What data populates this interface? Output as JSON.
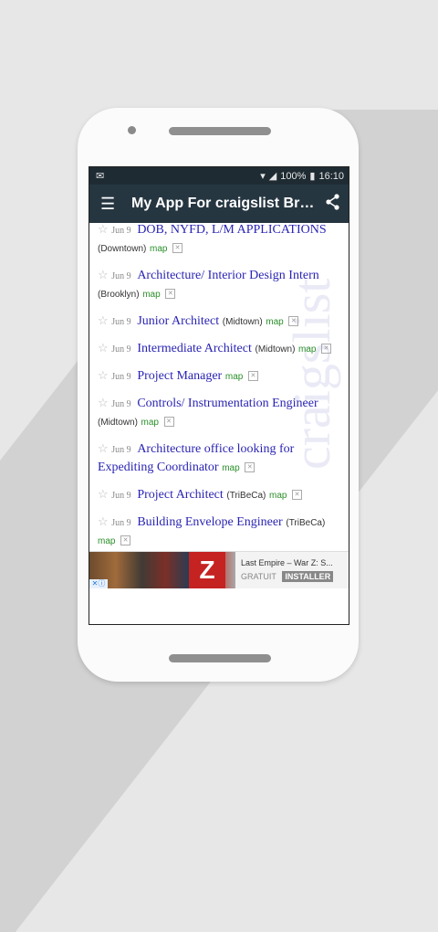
{
  "status_bar": {
    "notification_icon": "mail-icon",
    "battery": "100%",
    "time": "16:10"
  },
  "app_bar": {
    "title": "My App For craigslist Brow...",
    "menu_icon": "menu-icon",
    "share_icon": "share-icon"
  },
  "listings": [
    {
      "date": "Jun 9",
      "title": "DOB, NYFD, L/M APPLICATIONS",
      "location": "(Downtown)",
      "map": "map"
    },
    {
      "date": "Jun 9",
      "title": "Architecture/ Interior Design Intern",
      "location": "(Brooklyn)",
      "map": "map"
    },
    {
      "date": "Jun 9",
      "title": "Junior Architect",
      "location": "(Midtown)",
      "map": "map"
    },
    {
      "date": "Jun 9",
      "title": "Intermediate Architect",
      "location": "(Midtown)",
      "map": "map"
    },
    {
      "date": "Jun 9",
      "title": "Project Manager",
      "location": "",
      "map": "map"
    },
    {
      "date": "Jun 9",
      "title": "Controls/ Instrumentation Engineer",
      "location": "(Midtown)",
      "map": "map"
    },
    {
      "date": "Jun 9",
      "title": "Architecture office looking for Expediting Coordinator",
      "location": "",
      "map": "map"
    },
    {
      "date": "Jun 9",
      "title": "Project Architect",
      "location": "(TriBeCa)",
      "map": "map"
    },
    {
      "date": "Jun 9",
      "title": "Building Envelope Engineer",
      "location": "(TriBeCa)",
      "map": "map"
    }
  ],
  "ad": {
    "title": "Last Empire – War Z: S...",
    "gratuit": "GRATUIT",
    "install": "INSTALLER"
  },
  "watermark": "craigslist"
}
